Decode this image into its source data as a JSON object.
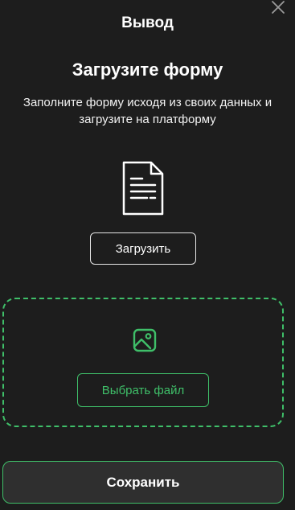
{
  "modal": {
    "title": "Вывод",
    "close_icon": "close-icon"
  },
  "content": {
    "heading": "Загрузите форму",
    "description": "Заполните форму исходя из своих данных и загрузите на платформу",
    "document_icon": "document-icon",
    "upload_label": "Загрузить"
  },
  "dropzone": {
    "image_icon": "image-icon",
    "choose_label": "Выбрать файл"
  },
  "footer": {
    "save_label": "Сохранить"
  },
  "colors": {
    "background": "#1d1d1d",
    "accent": "#3fbf69",
    "text": "#ffffff",
    "button_bg": "#2f2f2f"
  }
}
